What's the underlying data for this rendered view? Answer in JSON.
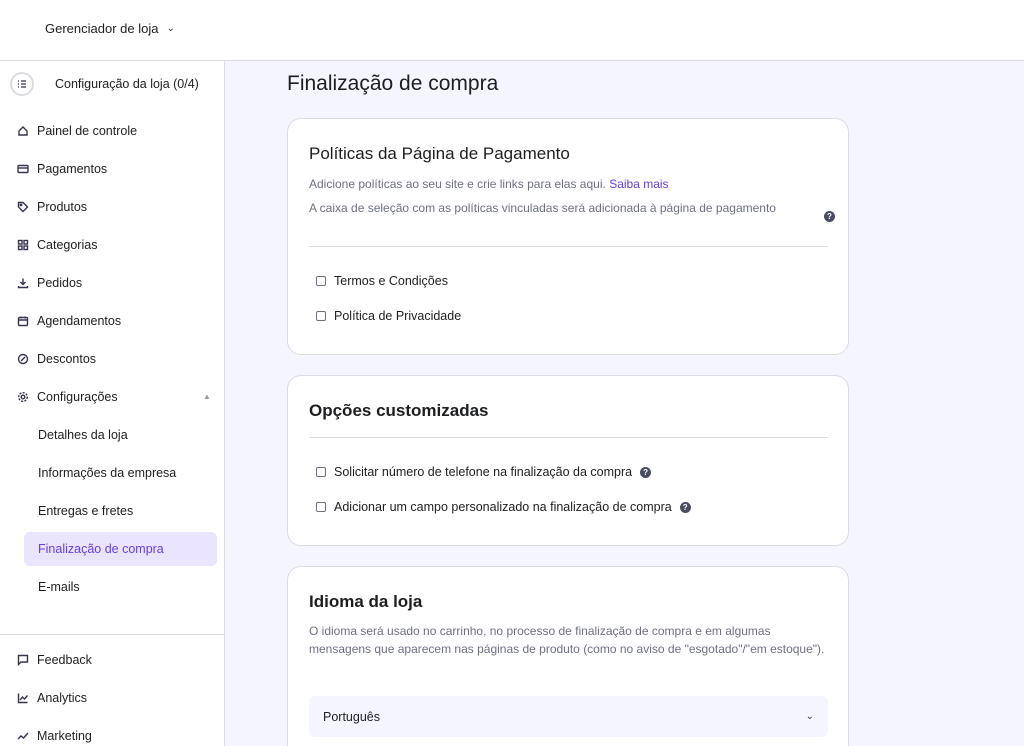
{
  "topbar": {
    "store_label": "Gerenciador de loja",
    "chevron": "⌄"
  },
  "sidebar": {
    "setup": {
      "label": "Configuração da loja (0/4)",
      "icon": "checklist-icon"
    },
    "items": [
      {
        "label": "Painel de controle",
        "icon": "home-icon"
      },
      {
        "label": "Pagamentos",
        "icon": "card-icon"
      },
      {
        "label": "Produtos",
        "icon": "tag-icon"
      },
      {
        "label": "Categorias",
        "icon": "grid-icon"
      },
      {
        "label": "Pedidos",
        "icon": "download-icon"
      },
      {
        "label": "Agendamentos",
        "icon": "calendar-icon"
      },
      {
        "label": "Descontos",
        "icon": "discount-icon"
      },
      {
        "label": "Configurações",
        "icon": "gear-icon"
      }
    ],
    "caret": "▲",
    "sub_items": [
      {
        "label": "Detalhes da loja"
      },
      {
        "label": "Informações da empresa"
      },
      {
        "label": "Entregas e fretes"
      },
      {
        "label": "Finalização de compra",
        "active": true
      },
      {
        "label": "E-mails"
      }
    ],
    "bottom_items": [
      {
        "label": "Feedback",
        "icon": "chat-icon"
      },
      {
        "label": "Analytics",
        "icon": "chart-icon"
      },
      {
        "label": "Marketing",
        "icon": "trend-icon"
      }
    ]
  },
  "main": {
    "title": "Finalização de compra",
    "policies": {
      "title": "Políticas da Página de Pagamento",
      "desc": "Adicione políticas ao seu site e crie links para elas aqui.",
      "link": "Saiba mais",
      "note": "A caixa de seleção com as políticas vinculadas será adicionada à página de pagamento",
      "options": [
        "Termos e Condições",
        "Política de Privacidade"
      ]
    },
    "custom": {
      "title": "Opções customizadas",
      "options": [
        "Solicitar número de telefone na finalização da compra",
        "Adicionar um campo personalizado na finalização de compra"
      ]
    },
    "language": {
      "title": "Idioma da loja",
      "desc": "O idioma será usado no carrinho, no processo de finalização de compra e em algumas mensagens que aparecem nas páginas de produto (como no aviso de \"esgotado\"/\"em estoque\").",
      "selected": "Português"
    },
    "help_glyph": "?"
  },
  "colors": {
    "accent": "#673de6",
    "accent_bg": "#ebe4ff",
    "page_bg": "#f4f5ff",
    "border": "#dadce0"
  }
}
